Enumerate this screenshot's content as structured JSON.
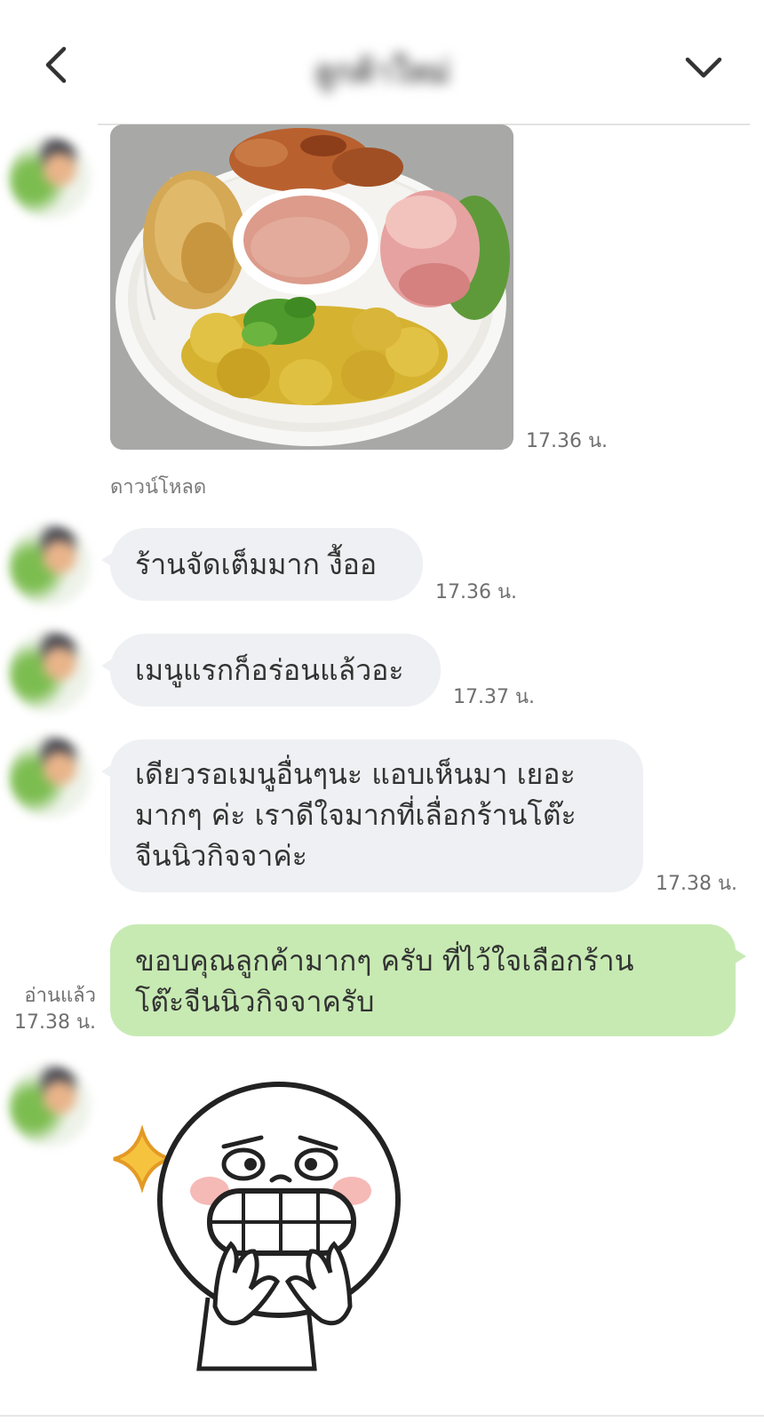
{
  "header": {
    "title": "ลูกค้าใหม่",
    "back_icon": "chevron-left-icon",
    "menu_icon": "chevron-down-icon"
  },
  "messages": [
    {
      "type": "image",
      "alt": "",
      "time": "17.36 น.",
      "download_label": "ดาวน์โหลด"
    },
    {
      "type": "text",
      "text": "ร้านจัดเต็มมาก  งื้ออ",
      "time": "17.36 น."
    },
    {
      "type": "text",
      "text": "เมนูแรกก็อร่อนแล้วอะ",
      "time": "17.37 น."
    },
    {
      "type": "text",
      "lines": [
        "เดียวรอเมนูอื่นๆนะ แอบเห็นมา เยอะ",
        "มากๆ ค่ะ เราดีใจมากที่เลื่อกร้านโต๊ะ",
        "จีนนิวกิจจาค่ะ"
      ],
      "time": "17.38 น."
    },
    {
      "type": "text_out",
      "lines": [
        "ขอบคุณลูกค้ามากๆ ครับ ที่ไว้ใจเลือกร้าน",
        "โต๊ะจีนนิวกิจจาครับ"
      ],
      "read_label": "อ่านแล้ว",
      "time": "17.38 น."
    },
    {
      "type": "sticker",
      "sticker_icon": "laughing-face-sticker"
    }
  ],
  "colors": {
    "incoming_bubble": "#eff0f3",
    "outgoing_bubble": "#c7eab3",
    "background": "#ffffff"
  }
}
